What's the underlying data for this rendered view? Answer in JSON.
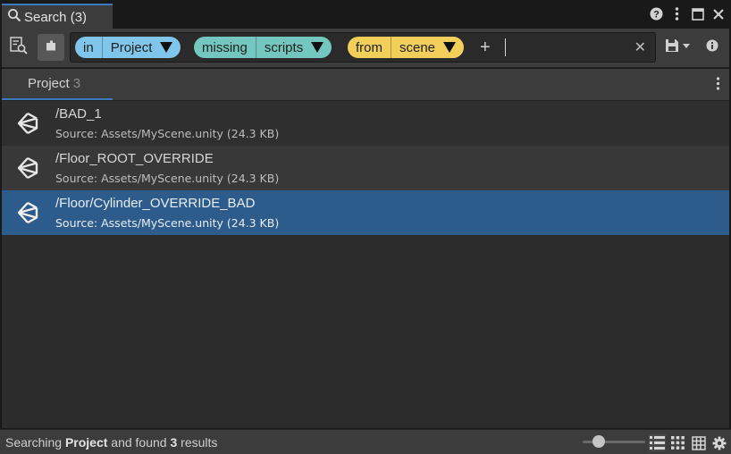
{
  "window": {
    "tab_title": "Search (3)"
  },
  "toolbar": {
    "query_chips": [
      {
        "key": "in",
        "value": "Project",
        "color": "#7fc6ea"
      },
      {
        "key": "missing",
        "value": "scripts",
        "color": "#74c7bf"
      },
      {
        "key": "from",
        "value": "scene",
        "color": "#f2cf5a"
      }
    ],
    "add_label": "+",
    "search_value": "",
    "clear_label": "✕"
  },
  "section": {
    "tab_label": "Project",
    "tab_count": "3"
  },
  "results": [
    {
      "label": "/BAD_1",
      "description": "Source: Assets/MyScene.unity (24.3 KB)",
      "selected": false
    },
    {
      "label": "/Floor_ROOT_OVERRIDE",
      "description": "Source: Assets/MyScene.unity (24.3 KB)",
      "selected": false
    },
    {
      "label": "/Floor/Cylinder_OVERRIDE_BAD",
      "description": "Source: Assets/MyScene.unity (24.3 KB)",
      "selected": true
    }
  ],
  "status": {
    "prefix": "Searching ",
    "provider": "Project",
    "middle": " and found ",
    "count": "3",
    "suffix": " results",
    "zoom_fraction": 0.25
  },
  "colors": {
    "accent": "#3a79bb",
    "selection": "#2d5b8b"
  },
  "icons": [
    "search-icon",
    "help-icon",
    "more-icon",
    "maximize-icon",
    "close-icon",
    "saved-searches-icon",
    "inspector-toggle-icon",
    "save-query-icon",
    "info-icon",
    "unity-prefab-icon",
    "list-view-icon",
    "grid-view-icon",
    "table-view-icon",
    "settings-icon"
  ]
}
